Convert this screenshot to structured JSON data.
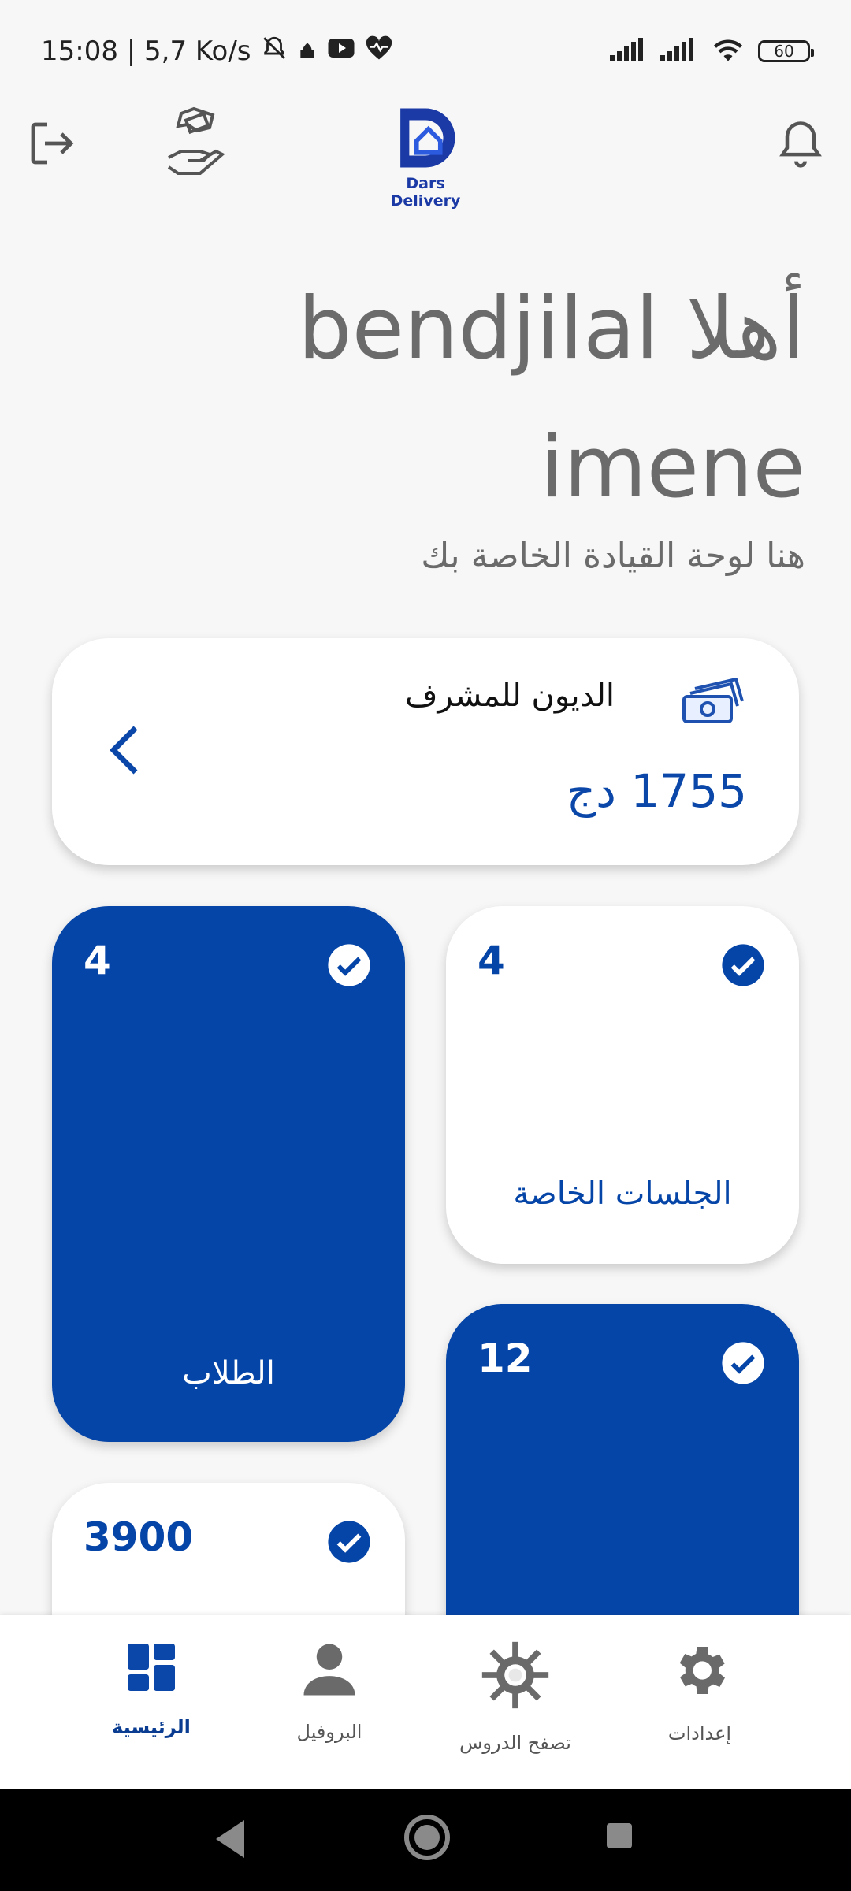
{
  "status_bar": {
    "time_speed": "15:08 | 5,7 Ko/s",
    "battery": "60"
  },
  "header": {
    "logo_text": "Dars Delivery"
  },
  "greeting": {
    "line1": "أهلا bendjilal",
    "line2": "imene",
    "subtitle": "هنا لوحة القيادة الخاصة بك"
  },
  "debt_card": {
    "title": "الديون للمشرف",
    "amount": "1755 دج"
  },
  "cards": [
    {
      "count": "4",
      "label": "الطلاب",
      "style": "blue"
    },
    {
      "count": "4",
      "label": "الجلسات الخاصة",
      "style": "white"
    },
    {
      "count": "12",
      "label": "",
      "style": "blue"
    },
    {
      "count": "3900",
      "label": "",
      "style": "white"
    }
  ],
  "bottom_nav": {
    "items": [
      {
        "label": "الرئيسية",
        "icon": "dashboard-icon",
        "active": true
      },
      {
        "label": "البروفيل",
        "icon": "person-icon",
        "active": false
      },
      {
        "label": "تصفح الدروس",
        "icon": "gear-cluster-icon",
        "active": false
      },
      {
        "label": "إعدادات",
        "icon": "settings-icon",
        "active": false
      }
    ]
  },
  "colors": {
    "primary": "#0645a8",
    "background": "#f7f7f7",
    "text_gray": "#6b6b6b"
  }
}
